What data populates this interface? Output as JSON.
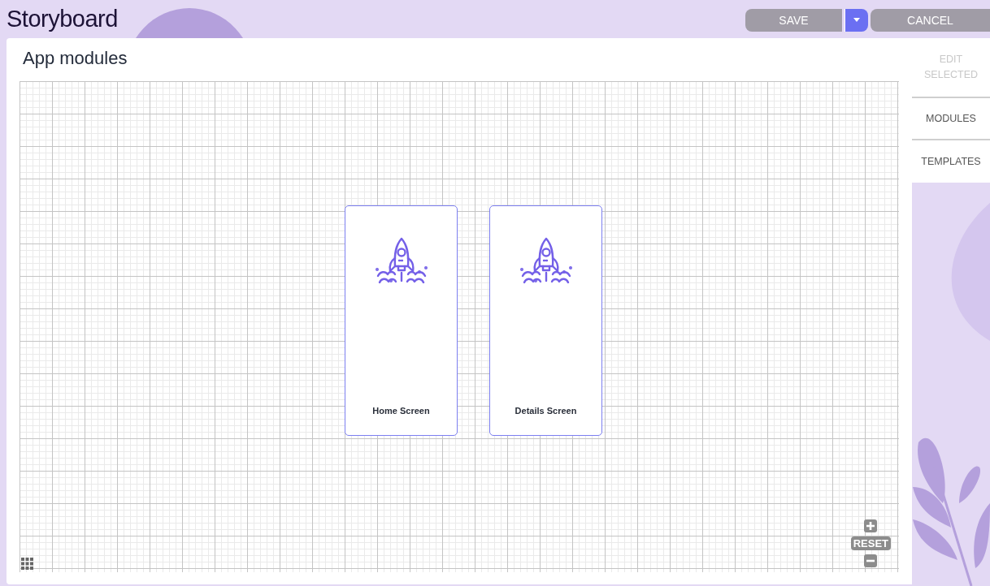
{
  "header": {
    "title": "Storyboard",
    "save_label": "SAVE",
    "cancel_label": "CANCEL"
  },
  "panel": {
    "title": "App modules"
  },
  "canvas": {
    "nodes": [
      {
        "label": "Home Screen"
      },
      {
        "label": "Details Screen"
      }
    ],
    "reset_label": "RESET"
  },
  "side_tabs": [
    {
      "label": "EDIT SELECTED",
      "disabled": true
    },
    {
      "label": "MODULES",
      "disabled": false
    },
    {
      "label": "TEMPLATES",
      "disabled": false
    }
  ]
}
